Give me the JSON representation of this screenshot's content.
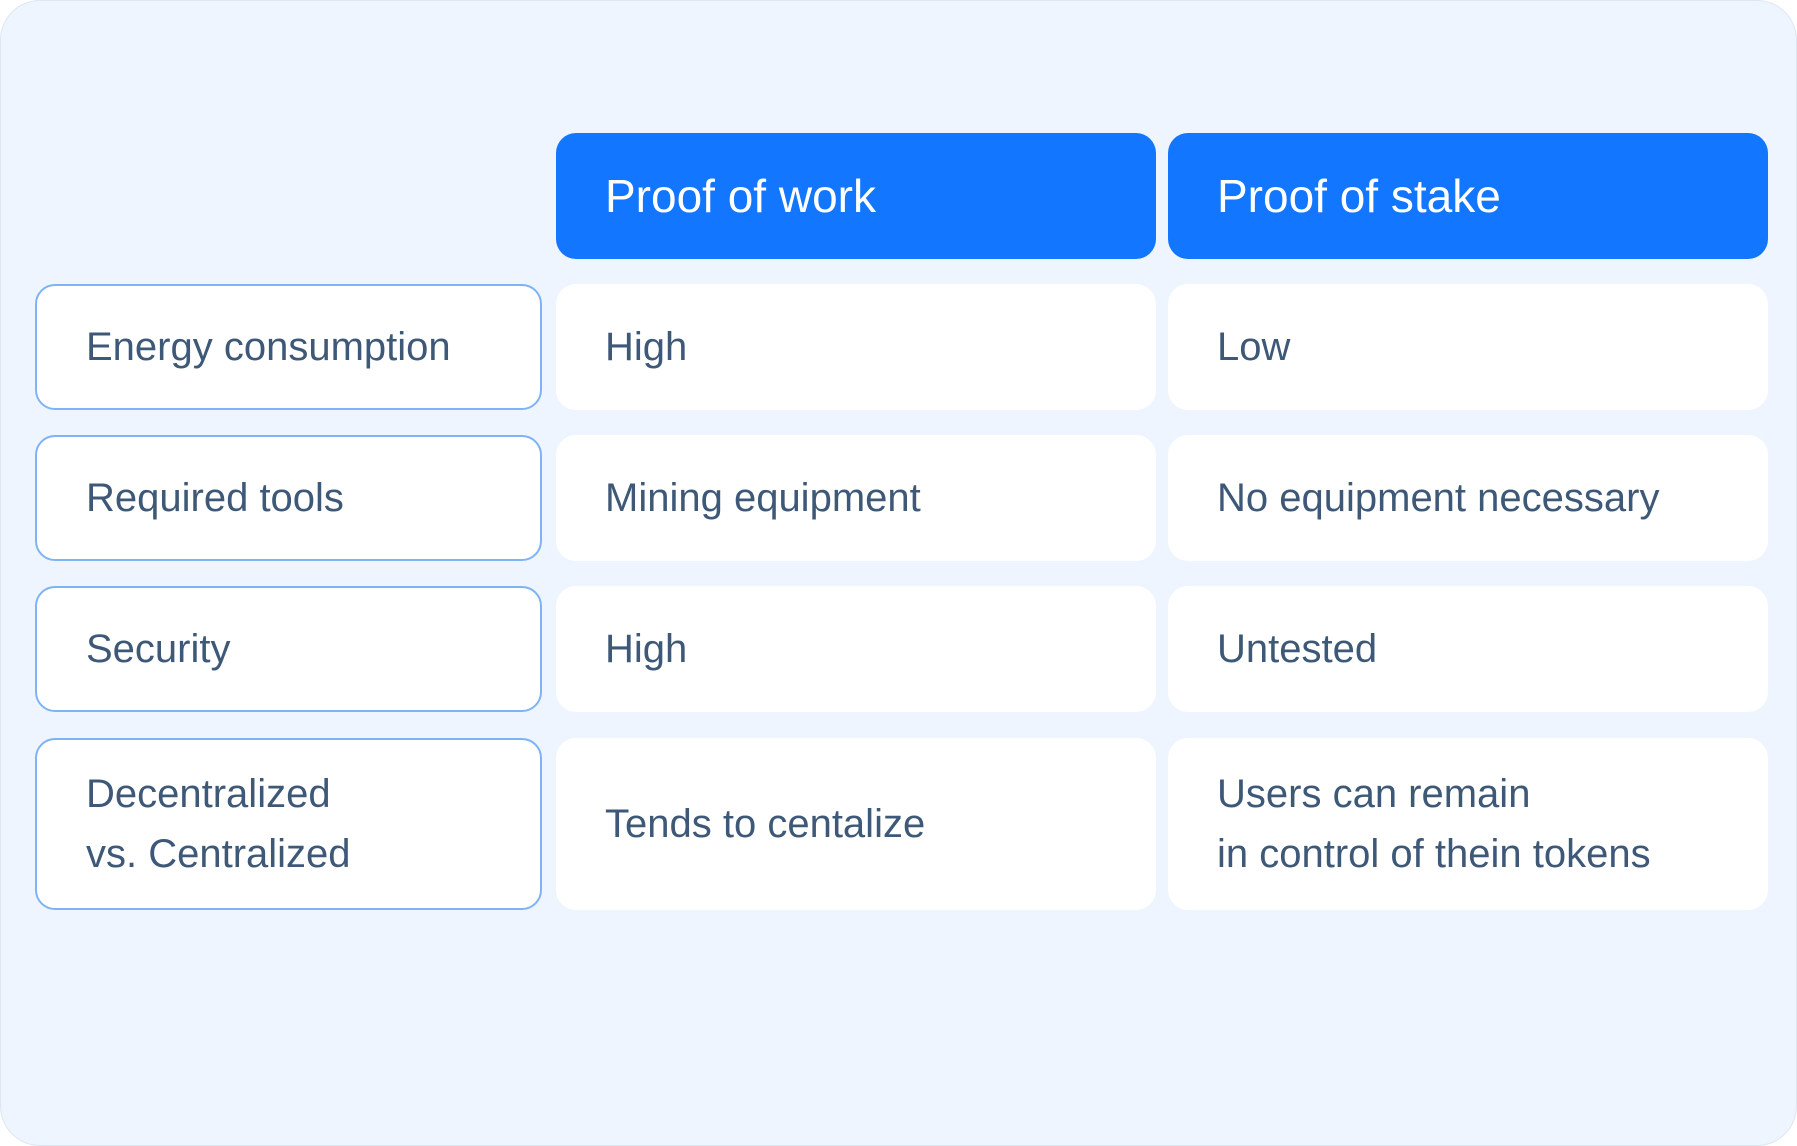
{
  "columns": [
    {
      "label": "Proof of work"
    },
    {
      "label": "Proof of stake"
    }
  ],
  "rows": [
    {
      "label": "Energy consumption",
      "pow": "High",
      "pos": "Low"
    },
    {
      "label": "Required tools",
      "pow": "Mining equipment",
      "pos": "No equipment necessary"
    },
    {
      "label": "Security",
      "pow": "High",
      "pos": "Untested"
    },
    {
      "label": "Decentralized\nvs. Centralized",
      "pow": "Tends to centalize",
      "pos": "Users can remain\nin control of thein tokens"
    }
  ],
  "colors": {
    "background": "#EFF5FE",
    "header": "#1276FF",
    "label_border": "#7EB3F5",
    "text": "#3E5878"
  }
}
